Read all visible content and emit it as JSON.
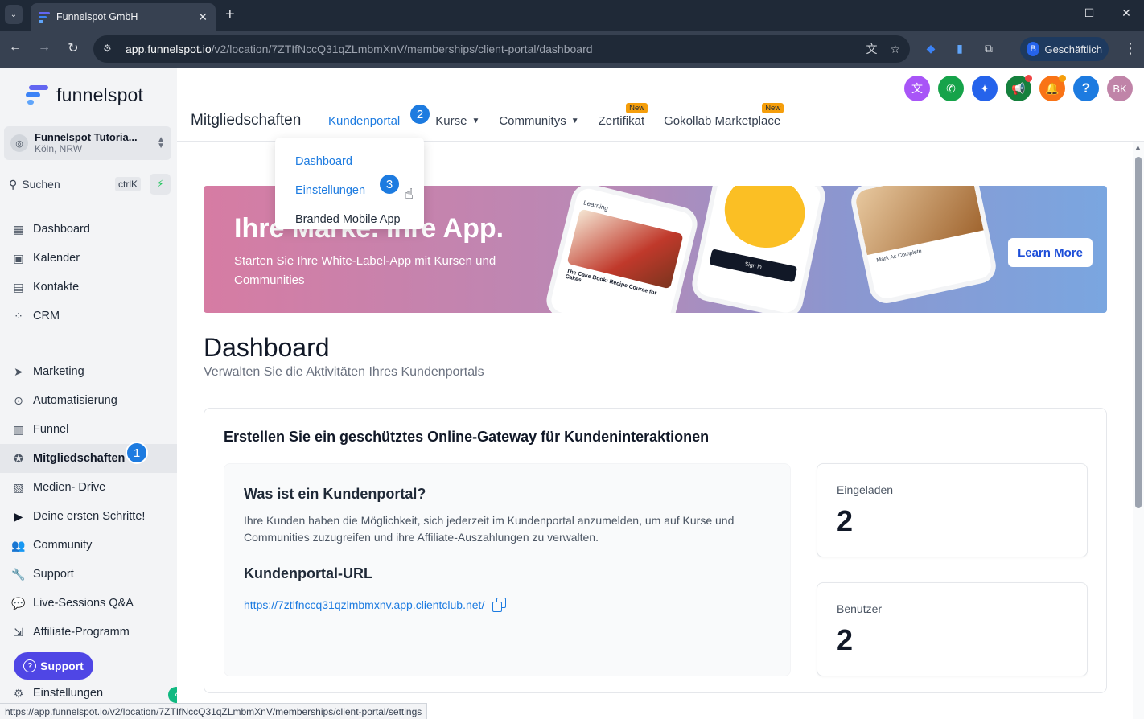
{
  "browser": {
    "tab_title": "Funnelspot GmbH",
    "url_host": "app.funnelspot.io",
    "url_path": "/v2/location/7ZTIfNccQ31qZLmbmXnV/memberships/client-portal/dashboard",
    "profile_initial": "B",
    "profile_label": "Geschäftlich",
    "status_url": "https://app.funnelspot.io/v2/location/7ZTIfNccQ31qZLmbmXnV/memberships/client-portal/settings"
  },
  "sidebar": {
    "logo_text": "funnelspot",
    "account_name": "Funnelspot Tutoria...",
    "account_location": "Köln, NRW",
    "search_placeholder": "Suchen",
    "search_shortcut": "ctrlK",
    "items_top": [
      {
        "label": "Dashboard",
        "icon": "grid-icon"
      },
      {
        "label": "Kalender",
        "icon": "calendar-icon"
      },
      {
        "label": "Kontakte",
        "icon": "contacts-icon"
      },
      {
        "label": "CRM",
        "icon": "crm-icon"
      }
    ],
    "items": [
      {
        "label": "Marketing",
        "icon": "send-icon"
      },
      {
        "label": "Automatisierung",
        "icon": "automation-icon"
      },
      {
        "label": "Funnel",
        "icon": "funnel-icon"
      },
      {
        "label": "Mitgliedschaften",
        "icon": "award-icon"
      },
      {
        "label": "Medien- Drive",
        "icon": "image-icon"
      },
      {
        "label": "Deine ersten Schritte!",
        "icon": "play-icon"
      },
      {
        "label": "Community",
        "icon": "users-icon"
      },
      {
        "label": "Support",
        "icon": "wrench-icon"
      },
      {
        "label": "Live-Sessions Q&A",
        "icon": "chat-icon"
      },
      {
        "label": "Affiliate-Programm",
        "icon": "affiliate-icon"
      }
    ],
    "settings_label": "Einstellungen",
    "support_button": "Support"
  },
  "steps": {
    "one": "1",
    "two": "2",
    "three": "3"
  },
  "topbar": {
    "heading": "Mitgliedschaften",
    "tabs": [
      {
        "label": "Kundenportal"
      },
      {
        "label": "Kurse"
      },
      {
        "label": "Communitys"
      },
      {
        "label": "Zertifikat",
        "badge": "New"
      },
      {
        "label": "Gokollab Marketplace",
        "badge": "New"
      }
    ],
    "user_initials": "BK"
  },
  "dropdown": {
    "items": [
      "Dashboard",
      "Einstellungen",
      "Branded Mobile App"
    ]
  },
  "banner": {
    "title": "Ihre Marke. Ihre App.",
    "subtitle": "Starten Sie Ihre White-Label-App mit Kursen und Communities",
    "cta": "Learn More",
    "phone1_header": "Learning",
    "phone1_caption": "The Cake Book: Recipe Course for Cakes",
    "phone2_button": "Sign in",
    "phone3_action": "Mark As Complete"
  },
  "main": {
    "title": "Dashboard",
    "subtitle": "Verwalten Sie die Aktivitäten Ihres Kundenportals",
    "card_title": "Erstellen Sie ein geschütztes Online-Gateway für Kundeninteraktionen",
    "info_heading": "Was ist ein Kundenportal?",
    "info_text": "Ihre Kunden haben die Möglichkeit, sich jederzeit im Kundenportal anzumelden, um auf Kurse und Communities zuzugreifen und ihre Affiliate-Auszahlungen zu verwalten.",
    "url_heading": "Kundenportal-URL",
    "portal_url": "https://7ztlfnccq31qzlmbmxnv.app.clientclub.net/",
    "stats": [
      {
        "label": "Eingeladen",
        "value": "2"
      },
      {
        "label": "Benutzer",
        "value": "2"
      }
    ]
  },
  "colors": {
    "accent": "#1d7be0",
    "support": "#4f46e5",
    "new_badge": "#f59e0b"
  }
}
